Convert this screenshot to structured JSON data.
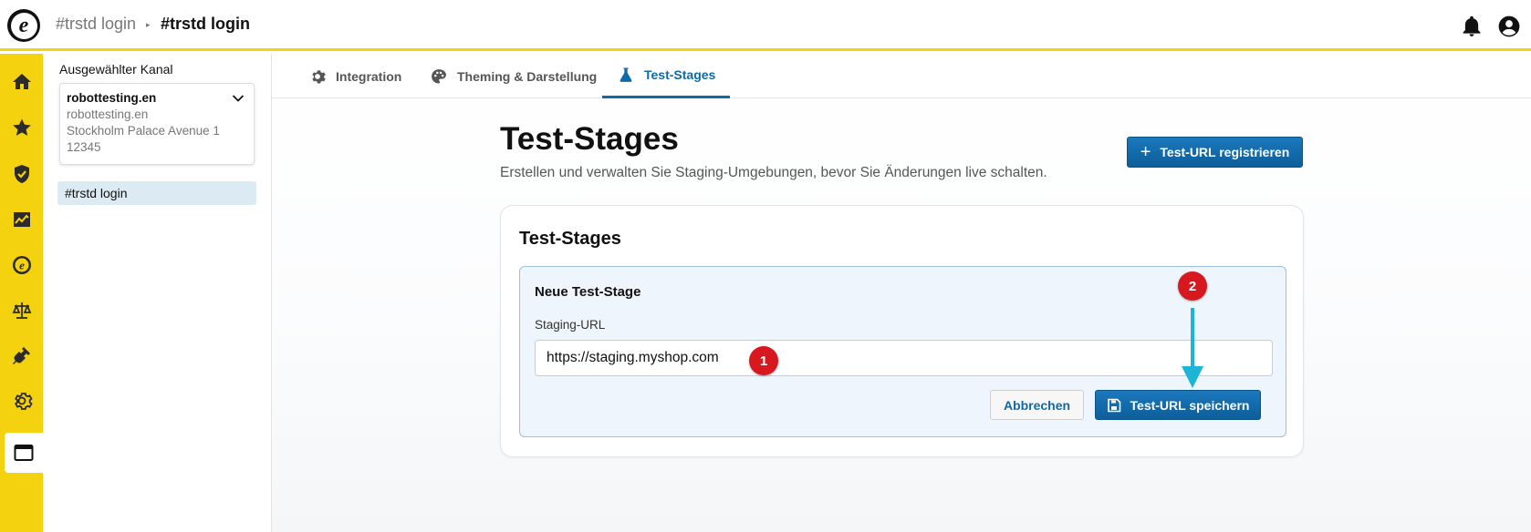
{
  "app": {
    "logo_letter": "e",
    "breadcrumb": [
      "#trstd login",
      "#trstd login"
    ],
    "breadcrumb_separator": "▸"
  },
  "header_icons": [
    "bell-icon",
    "user-account-icon"
  ],
  "rail": {
    "items": [
      {
        "name": "home-icon"
      },
      {
        "name": "star-icon"
      },
      {
        "name": "shield-check-icon"
      },
      {
        "name": "chart-icon"
      },
      {
        "name": "trusted-e-icon"
      },
      {
        "name": "scales-icon"
      },
      {
        "name": "plug-icon"
      },
      {
        "name": "gear-icon"
      },
      {
        "name": "browser-window-icon",
        "active": true
      }
    ]
  },
  "channel_panel": {
    "label": "Ausgewählter Kanal",
    "selected": {
      "name": "robottesting.en",
      "domain": "robottesting.en",
      "address": "Stockholm Palace Avenue 1",
      "zip": "12345"
    },
    "shops": [
      "#trstd login"
    ]
  },
  "tabs": [
    {
      "label": "Integration",
      "icon": "gear-icon",
      "active": false
    },
    {
      "label": "Theming & Darstellung",
      "icon": "palette-icon",
      "active": false
    },
    {
      "label": "Test-Stages",
      "icon": "flask-icon",
      "active": true
    }
  ],
  "page": {
    "title": "Test-Stages",
    "subtitle": "Erstellen und verwalten Sie Staging-Umgebungen, bevor Sie Änderungen live schalten.",
    "register_button": "Test-URL registrieren"
  },
  "card": {
    "title": "Test-Stages",
    "form": {
      "title": "Neue Test-Stage",
      "field_label": "Staging-URL",
      "url_value": "https://staging.myshop.com",
      "cancel_label": "Abbrechen",
      "save_label": "Test-URL speichern"
    }
  },
  "annotations": {
    "marker_1": "1",
    "marker_2": "2"
  },
  "colors": {
    "brand_yellow": "#f5d20f",
    "accent_blue": "#0e6aa8",
    "marker_red": "#d7191f",
    "arrow_cyan": "#1eb4d6"
  }
}
